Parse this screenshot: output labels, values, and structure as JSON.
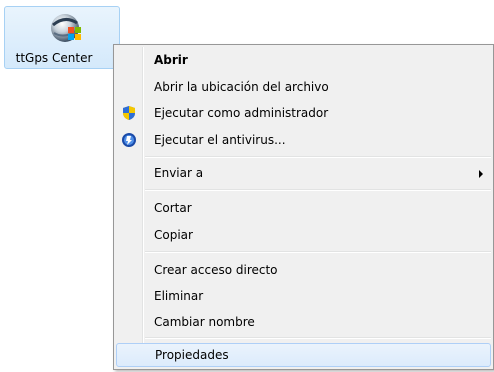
{
  "desktop": {
    "selected_icon": {
      "label": "ttGps Center",
      "icon": "ttgps-center-app-icon"
    }
  },
  "context_menu": {
    "items": [
      {
        "label": "Abrir",
        "bold": true
      },
      {
        "label": "Abrir la ubicación del archivo"
      },
      {
        "label": "Ejecutar como administrador",
        "icon": "uac-shield-icon"
      },
      {
        "label": "Ejecutar el antivirus...",
        "icon": "antivirus-icon"
      },
      {
        "label": "Enviar a",
        "submenu": true
      },
      {
        "label": "Cortar"
      },
      {
        "label": "Copiar"
      },
      {
        "label": "Crear acceso directo"
      },
      {
        "label": "Eliminar"
      },
      {
        "label": "Cambiar nombre"
      },
      {
        "label": "Propiedades",
        "hovered": true
      }
    ]
  },
  "colors": {
    "menu_background": "#f0f0f0",
    "menu_border": "#979797",
    "hover_background": "#dcebfc",
    "hover_border": "#aecff7",
    "icon_selection_background": "#dcecfc",
    "icon_selection_border": "#a7d1f4"
  }
}
